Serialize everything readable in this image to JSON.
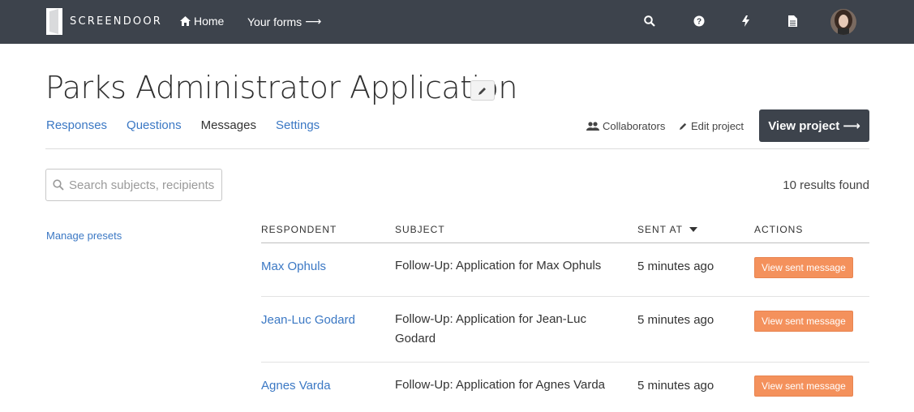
{
  "app": {
    "logo_text": "SCREENDOOR",
    "nav": {
      "home": "Home",
      "forms": "Your forms",
      "forms_arrow": "⟶"
    },
    "icons": [
      "search-icon",
      "help-icon",
      "bolt-icon",
      "document-icon"
    ]
  },
  "page": {
    "title": "Parks Administrator Application",
    "tabs": [
      {
        "label": "Responses"
      },
      {
        "label": "Questions"
      },
      {
        "label": "Messages",
        "active": true
      },
      {
        "label": "Settings"
      }
    ],
    "actions": {
      "collaborators": "Collaborators",
      "edit_project": "Edit project",
      "view_project": "View project",
      "view_project_arrow": "⟶"
    }
  },
  "sidebar": {
    "search_placeholder": "Search subjects, recipients",
    "manage_presets": "Manage presets"
  },
  "results": {
    "count_text": "10 results found"
  },
  "table": {
    "headers": {
      "respondent": "RESPONDENT",
      "subject": "SUBJECT",
      "sent_at": "SENT AT",
      "actions": "ACTIONS"
    },
    "rows": [
      {
        "respondent": "Max Ophuls",
        "subject": "Follow-Up: Application for Max Ophuls",
        "sent_at": "5 minutes ago",
        "action": "View sent message"
      },
      {
        "respondent": "Jean-Luc Godard",
        "subject": "Follow-Up: Application for Jean-Luc Godard",
        "sent_at": "5 minutes ago",
        "action": "View sent message"
      },
      {
        "respondent": "Agnes Varda",
        "subject": "Follow-Up: Application for Agnes Varda",
        "sent_at": "5 minutes ago",
        "action": "View sent message"
      }
    ]
  },
  "colors": {
    "navbar": "#3d434c",
    "link": "#3b78c4",
    "action_button": "#f4915c"
  }
}
